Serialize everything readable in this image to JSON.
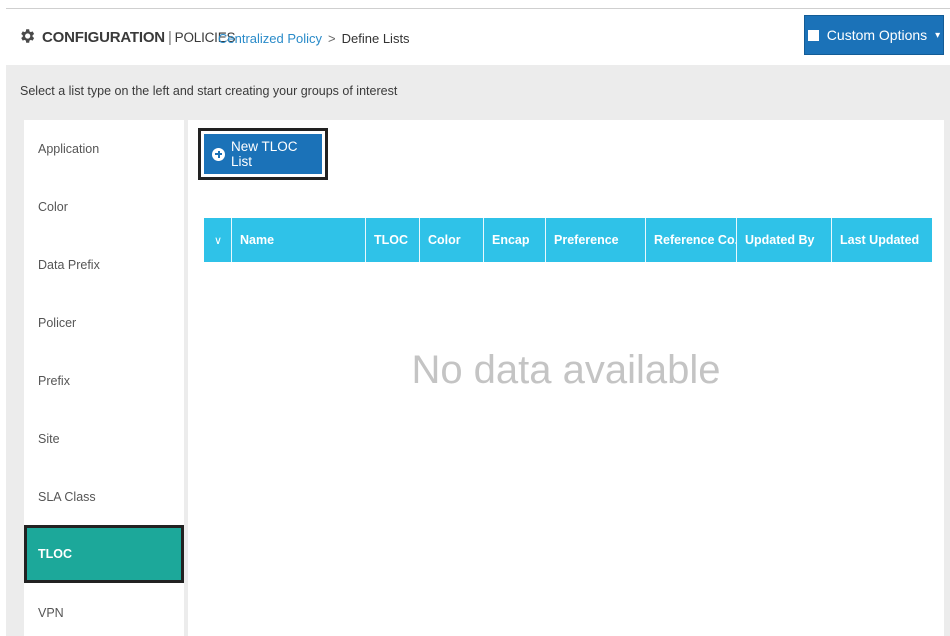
{
  "header": {
    "title_main": "CONFIGURATION",
    "title_sep": "|",
    "title_sub": "POLICIES",
    "breadcrumb": {
      "link": "Centralized Policy",
      "arrow": ">",
      "current": "Define Lists"
    },
    "custom_options_label": "Custom Options",
    "custom_options_caret": "▾"
  },
  "instruction": "Select a list type on the left and start creating your groups of interest",
  "sidebar": {
    "items": [
      {
        "label": "Application"
      },
      {
        "label": "Color"
      },
      {
        "label": "Data Prefix"
      },
      {
        "label": "Policer"
      },
      {
        "label": "Prefix"
      },
      {
        "label": "Site"
      },
      {
        "label": "SLA Class"
      },
      {
        "label": "TLOC",
        "active": true
      },
      {
        "label": "VPN"
      }
    ]
  },
  "main": {
    "new_button_label": "New TLOC List",
    "table": {
      "select_glyph": "∨",
      "columns": [
        "Name",
        "TLOC",
        "Color",
        "Encap",
        "Preference",
        "Reference Co...",
        "Updated By",
        "Last Updated"
      ]
    },
    "empty_text": "No data available"
  },
  "colors": {
    "primary_blue": "#1b72b8",
    "header_cyan": "#2fc2e8",
    "active_teal": "#1ca89a",
    "link_blue": "#2a8bc9"
  }
}
